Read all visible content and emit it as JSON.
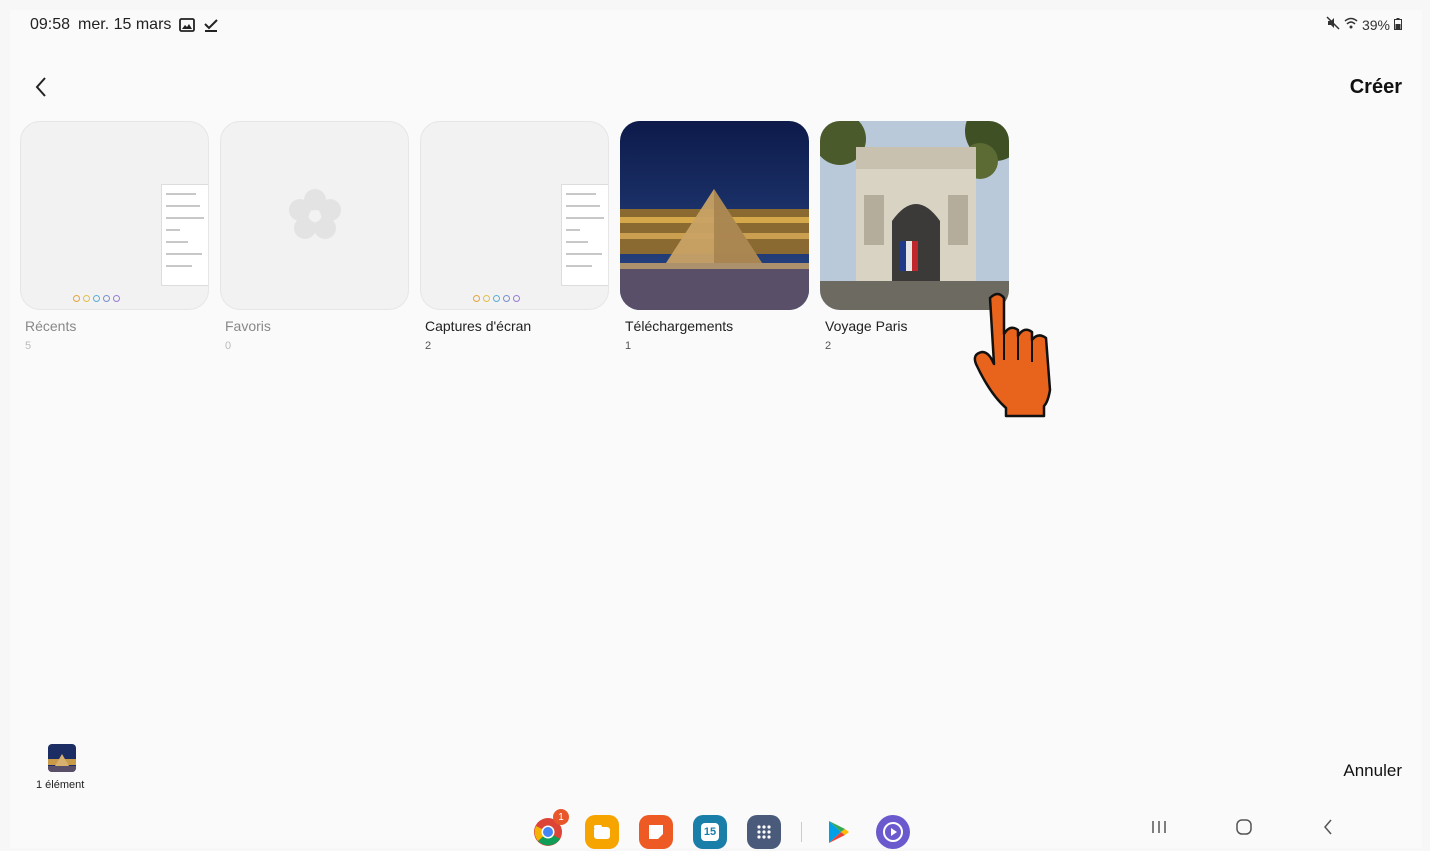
{
  "status": {
    "time": "09:58",
    "date": "mer. 15 mars",
    "battery": "39%"
  },
  "header": {
    "create_label": "Créer"
  },
  "albums": [
    {
      "title": "Récents",
      "count": "5"
    },
    {
      "title": "Favoris",
      "count": "0"
    },
    {
      "title": "Captures d'écran",
      "count": "2"
    },
    {
      "title": "Téléchargements",
      "count": "1"
    },
    {
      "title": "Voyage Paris",
      "count": "2"
    }
  ],
  "selection": {
    "label": "1 élément"
  },
  "footer": {
    "cancel_label": "Annuler"
  },
  "dock": {
    "calendar_day": "15",
    "chrome_badge": "1"
  },
  "colors": {
    "accent_hand": "#e8631c",
    "files": "#f5a400",
    "notes": "#ee5a24",
    "calendar": "#1a7fa8"
  }
}
